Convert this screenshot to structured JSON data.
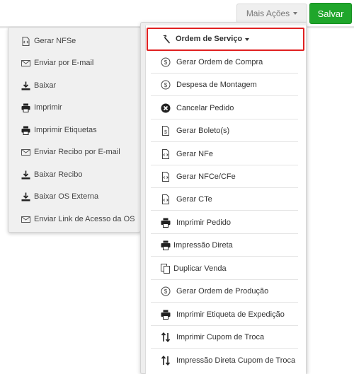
{
  "toolbar": {
    "actions_label": "Mais Ações",
    "save_label": "Salvar",
    "save_color": "#1fa62b"
  },
  "left_menu": {
    "items": [
      {
        "label": "Gerar NFSe",
        "icon": "file-code-icon"
      },
      {
        "label": "Enviar por E-mail",
        "icon": "envelope-icon"
      },
      {
        "label": "Baixar",
        "icon": "download-icon"
      },
      {
        "label": "Imprimir",
        "icon": "printer-icon"
      },
      {
        "label": "Imprimir Etiquetas",
        "icon": "printer-icon"
      },
      {
        "label": "Enviar Recibo por E-mail",
        "icon": "envelope-icon"
      },
      {
        "label": "Baixar Recibo",
        "icon": "download-icon"
      },
      {
        "label": "Baixar OS Externa",
        "icon": "download-icon"
      },
      {
        "label": "Enviar Link de Acesso da OS",
        "icon": "envelope-icon"
      }
    ]
  },
  "right_menu": {
    "header_label": "Ordem de Serviço",
    "header_icon": "hammer-icon",
    "highlight_color": "#e02020",
    "items": [
      {
        "label": "Gerar Ordem de Compra",
        "icon": "dollar-circle-icon"
      },
      {
        "label": "Despesa de Montagem",
        "icon": "dollar-circle-icon"
      },
      {
        "label": "Cancelar Pedido",
        "icon": "times-circle-icon"
      },
      {
        "label": "Gerar Boleto(s)",
        "icon": "file-invoice-icon"
      },
      {
        "label": "Gerar NFe",
        "icon": "file-code-icon"
      },
      {
        "label": "Gerar NFCe/CFe",
        "icon": "file-code-icon"
      },
      {
        "label": "Gerar CTe",
        "icon": "file-code-icon"
      },
      {
        "label": "Imprimir Pedido",
        "icon": "printer-icon"
      },
      {
        "label": "Impressão Direta",
        "icon": "printer-icon"
      },
      {
        "label": "Duplicar Venda",
        "icon": "copy-icon"
      },
      {
        "label": "Gerar Ordem de Produção",
        "icon": "dollar-circle-icon"
      },
      {
        "label": "Imprimir Etiqueta de Expedição",
        "icon": "printer-icon"
      },
      {
        "label": "Imprimir Cupom de Troca",
        "icon": "exchange-vertical-icon"
      },
      {
        "label": "Impressão Direta Cupom de Troca",
        "icon": "exchange-vertical-icon"
      }
    ]
  }
}
